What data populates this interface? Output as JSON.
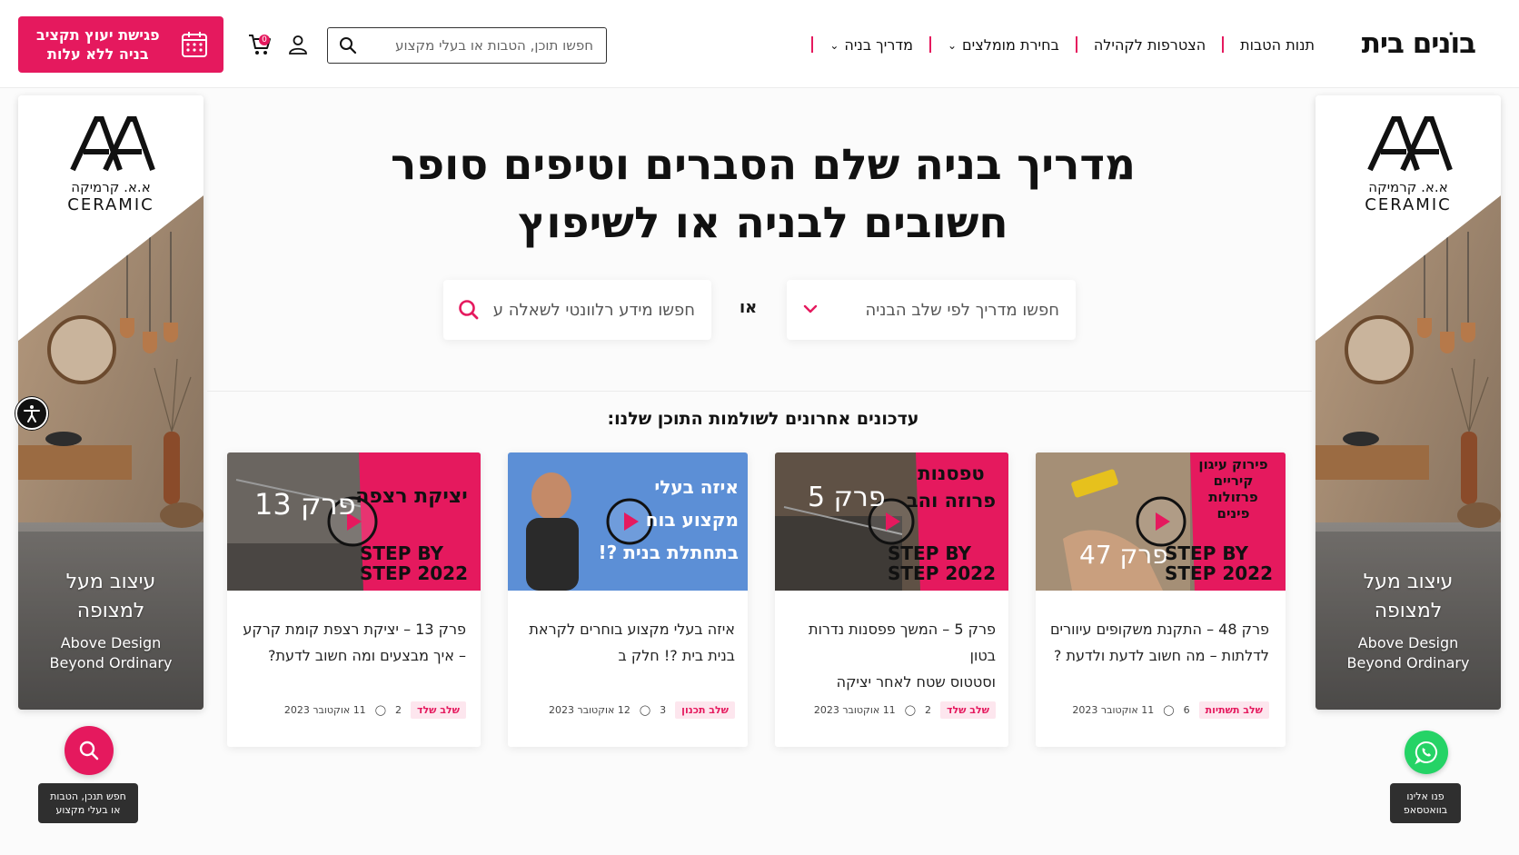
{
  "header": {
    "logo": "בוֹנים בית",
    "nav": [
      {
        "label": "מדריך בניה",
        "has_dropdown": true
      },
      {
        "label": "בחירת מומלצים",
        "has_dropdown": true
      },
      {
        "label": "הצטרפות לקהילה",
        "has_dropdown": false
      },
      {
        "label": "תנות הטבות",
        "has_dropdown": false
      }
    ],
    "search_placeholder": "חפשו תוכן, הטבות או בעלי מקצוע",
    "cart_count": "0",
    "cta_line1": "פגישת יעוץ תקציב",
    "cta_line2": "בניה ללא עלות"
  },
  "banner": {
    "logo_mark": "AA",
    "brand_he": "א.א. קרמיקה",
    "brand_en": "CERAMIC",
    "headline_line1": "עיצוב מעל",
    "headline_line2": "למצופה",
    "sub_line1": "Above Design",
    "sub_line2": "Beyond Ordinary"
  },
  "hero": {
    "title_line1": "מדריך בניה שלם הסברים וטיפים סופר",
    "title_line2": "חשובים לבניה או לשיפוץ",
    "stage_placeholder": "חפשו מדריך לפי שלב הבניה",
    "or": "או",
    "query_placeholder": "חפשו מידע רלוונטי לשאלה ע"
  },
  "section_title": "עדכונים אחרונים לשולמות התוכן שלנו:",
  "cards": [
    {
      "title_line1": "פרק 48 – התקנת משקופים עיוורים",
      "title_line2": "לדלתות – מה חשוב לדעת ולדעת ?",
      "tag": "שלב תשתיות",
      "stat": "6",
      "date": "11 אוקטובר 2023",
      "thumb_lines": [
        "פירוק עיגון",
        "קיריים",
        "פרזולות",
        "פינים"
      ],
      "thumb_episode": "פרק 47",
      "thumb_brand1": "STEP BY",
      "thumb_brand2": "STEP 2022"
    },
    {
      "title_line1": "פרק 5 – המשך פפסנות נדרות בטון",
      "title_line2": "וסטטוס שטח לאחר יציקה",
      "tag": "שלב שלד",
      "stat": "2",
      "date": "11 אוקטובר 2023",
      "thumb_lines": [
        "טפסנות",
        "פרוזה והב"
      ],
      "thumb_episode": "פרק 5",
      "thumb_brand1": "STEP BY",
      "thumb_brand2": "STEP 2022"
    },
    {
      "title_line1": "איזה בעלי מקצוע בוחרים לקראת",
      "title_line2": "בנית בית ?! חלק ב",
      "tag": "שלב תכנון",
      "stat": "3",
      "date": "12 אוקטובר 2023",
      "thumb_lines": [
        "איזה בעלי",
        "מקצוע בוח",
        "בתחתלת בנית ?!"
      ],
      "thumb_episode": "",
      "thumb_brand1": "",
      "thumb_brand2": ""
    },
    {
      "title_line1": "פרק 13 – יציקת רצפת קומת קרקע",
      "title_line2": "– איך מבצעים ומה חשוב לדעת?",
      "tag": "שלב שלד",
      "stat": "2",
      "date": "11 אוקטובר 2023",
      "thumb_lines": [
        "יציקת רצפה"
      ],
      "thumb_episode": "פרק 13",
      "thumb_brand1": "STEP BY",
      "thumb_brand2": "STEP 2022"
    }
  ],
  "floating": {
    "search_tip_line1": "חפש תנכן, הטבות",
    "search_tip_line2": "או בעלי מקצוע",
    "whatsapp_tip_line1": "פנו אלינו",
    "whatsapp_tip_line2": "בוואטסאפ"
  },
  "colors": {
    "accent": "#e5195e",
    "whatsapp": "#25d366",
    "tooltip": "#2f2f2f"
  },
  "icons": [
    "search-icon",
    "user-icon",
    "cart-icon",
    "calendar-icon",
    "chevron-down-icon",
    "play-icon",
    "whatsapp-icon",
    "accessibility-icon"
  ]
}
